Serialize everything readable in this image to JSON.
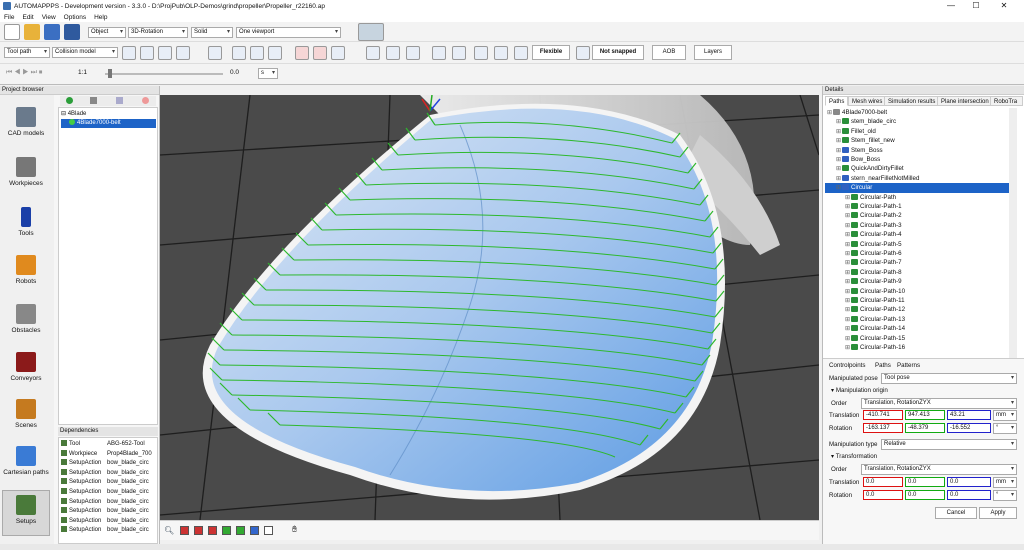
{
  "window": {
    "title": "AUTOMAPPPS - Development version - 3.3.0 - D:\\ProjPub\\OLP-Demos\\grind\\propeller\\Propeller_r22160.ap",
    "min": "—",
    "max": "☐",
    "close": "✕"
  },
  "menu": [
    "File",
    "Edit",
    "View",
    "Options",
    "Help"
  ],
  "toolbar1": {
    "object_combo": "Object",
    "rotation_combo": "3D-Rotation",
    "shading_combo": "Solid",
    "viewport_combo": "One viewport"
  },
  "toolbar2": {
    "toolpath_combo": "Tool path",
    "collision_combo": "Collision model",
    "flexible": "Flexible",
    "snap": "Not snapped",
    "aob": "AOB",
    "layers": "Layers"
  },
  "toolbar3": {
    "speed": "1:1",
    "time_value": "0.0",
    "time_unit": "s"
  },
  "left_panel": {
    "title": "Project browser",
    "nav": [
      "CAD models",
      "Workpieces",
      "Tools",
      "Robots",
      "Obstacles",
      "Conveyors",
      "Scenes",
      "Cartesian paths",
      "Setups"
    ],
    "tree": {
      "root": "4Blade",
      "child": "4Blade7000-belt"
    },
    "dependencies_title": "Dependencies",
    "dependencies": [
      [
        "Tool",
        "ABG-652-Tool"
      ],
      [
        "Workpiece",
        "Prop4Blade_700"
      ],
      [
        "SetupAction",
        "bow_blade_circ"
      ],
      [
        "SetupAction",
        "bow_blade_circ"
      ],
      [
        "SetupAction",
        "bow_blade_circ"
      ],
      [
        "SetupAction",
        "bow_blade_circ"
      ],
      [
        "SetupAction",
        "bow_blade_circ"
      ],
      [
        "SetupAction",
        "bow_blade_circ"
      ],
      [
        "SetupAction",
        "bow_blade_circ"
      ],
      [
        "SetupAction",
        "bow_blade_circ"
      ]
    ]
  },
  "right_panel": {
    "title": "Details",
    "tabs": [
      "Paths",
      "Mesh wires",
      "Simulation results",
      "Plane intersection",
      "RoboTra"
    ],
    "tree": [
      {
        "label": "4Blade7000-belt",
        "level": 0,
        "icon": "#888"
      },
      {
        "label": "stem_blade_circ",
        "level": 1,
        "icon": "#2a8f3a"
      },
      {
        "label": "Fillet_old",
        "level": 1,
        "icon": "#2a8f3a"
      },
      {
        "label": "Stem_fillet_new",
        "level": 1,
        "icon": "#2a8f3a"
      },
      {
        "label": "Stem_Boss",
        "level": 1,
        "icon": "#3060c0"
      },
      {
        "label": "Bow_Boss",
        "level": 1,
        "icon": "#3060c0"
      },
      {
        "label": "QuickAndDirtyFillet",
        "level": 1,
        "icon": "#2a8f3a"
      },
      {
        "label": "stern_nearFilletNotMilled",
        "level": 1,
        "icon": "#3060c0"
      },
      {
        "label": "Circular",
        "level": 1,
        "icon": "#3060c0",
        "selected": true
      },
      {
        "label": "Circular-Path",
        "level": 2,
        "icon": "#2a8f3a"
      },
      {
        "label": "Circular-Path-1",
        "level": 2,
        "icon": "#2a8f3a"
      },
      {
        "label": "Circular-Path-2",
        "level": 2,
        "icon": "#2a8f3a"
      },
      {
        "label": "Circular-Path-3",
        "level": 2,
        "icon": "#2a8f3a"
      },
      {
        "label": "Circular-Path-4",
        "level": 2,
        "icon": "#2a8f3a"
      },
      {
        "label": "Circular-Path-5",
        "level": 2,
        "icon": "#2a8f3a"
      },
      {
        "label": "Circular-Path-6",
        "level": 2,
        "icon": "#2a8f3a"
      },
      {
        "label": "Circular-Path-7",
        "level": 2,
        "icon": "#2a8f3a"
      },
      {
        "label": "Circular-Path-8",
        "level": 2,
        "icon": "#2a8f3a"
      },
      {
        "label": "Circular-Path-9",
        "level": 2,
        "icon": "#2a8f3a"
      },
      {
        "label": "Circular-Path-10",
        "level": 2,
        "icon": "#2a8f3a"
      },
      {
        "label": "Circular-Path-11",
        "level": 2,
        "icon": "#2a8f3a"
      },
      {
        "label": "Circular-Path-12",
        "level": 2,
        "icon": "#2a8f3a"
      },
      {
        "label": "Circular-Path-13",
        "level": 2,
        "icon": "#2a8f3a"
      },
      {
        "label": "Circular-Path-14",
        "level": 2,
        "icon": "#2a8f3a"
      },
      {
        "label": "Circular-Path-15",
        "level": 2,
        "icon": "#2a8f3a"
      },
      {
        "label": "Circular-Path-16",
        "level": 2,
        "icon": "#2a8f3a"
      }
    ],
    "bottom_tabs": [
      "Controlpoints",
      "Paths",
      "Patterns"
    ],
    "manip_pose_label": "Manipulated pose",
    "manip_pose_value": "Tool pose",
    "origin_header": "Manipulation origin",
    "order_label": "Order",
    "order_value": "Translation, RotationZYX",
    "translation_label": "Translation",
    "translation": [
      "-410.741",
      "947.413",
      "43.21"
    ],
    "translation_unit": "mm",
    "rotation_label": "Rotation",
    "rotation": [
      "-163.137",
      "-48.379",
      "-16.552"
    ],
    "rotation_unit": "°",
    "manip_type_label": "Manipulation type",
    "manip_type_value": "Relative",
    "transform_header": "Transformation",
    "order2_value": "Translation, RotationZYX",
    "translation2": [
      "0.0",
      "0.0",
      "0.0"
    ],
    "rotation2": [
      "0.0",
      "0.0",
      "0.0"
    ],
    "cancel": "Cancel",
    "apply": "Apply"
  }
}
